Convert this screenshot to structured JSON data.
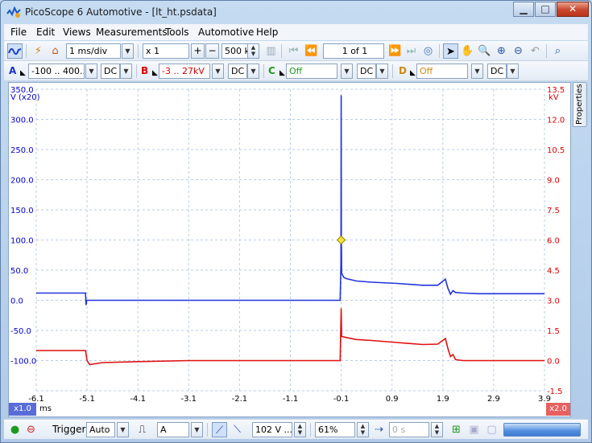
{
  "window": {
    "title": "PicoScope 6 Automotive - [lt_ht.psdata]"
  },
  "menu": [
    "File",
    "Edit",
    "Views",
    "Measurements",
    "Tools",
    "Automotive",
    "Help"
  ],
  "toolbar": {
    "timebase": "1 ms/div",
    "zoom": "x 1",
    "samples": "500 kS",
    "page": "1 of 1"
  },
  "channels": {
    "a": {
      "letter": "A",
      "range": "-100 .. 400...",
      "coupling": "DC"
    },
    "b": {
      "letter": "B",
      "range": "-3 .. 27kV",
      "coupling": "DC"
    },
    "c": {
      "letter": "C",
      "range": "Off",
      "coupling": "DC"
    },
    "d": {
      "letter": "D",
      "range": "Off",
      "coupling": "DC"
    }
  },
  "plot": {
    "left_unit": "V (x20)",
    "right_unit": "kV",
    "x_unit": "ms",
    "left_zoom": "x1.0",
    "right_zoom": "x2.0",
    "properties_tab": "Properties"
  },
  "status": {
    "trigger_label": "Trigger",
    "trigger_mode": "Auto",
    "trigger_channel": "A",
    "trigger_level": "102 V ...",
    "pretrigger": "61%",
    "delay": "0 s"
  },
  "colors": {
    "channel_a": "#2233dd",
    "channel_b": "#e01010",
    "marker": "#f2e23a"
  },
  "chart_data": {
    "type": "line",
    "x_ticks": [
      "-6.1",
      "-5.1",
      "-4.1",
      "-3.1",
      "-2.1",
      "-1.1",
      "-0.1",
      "0.9",
      "1.9",
      "2.9",
      "3.9"
    ],
    "y_left_ticks": [
      "350.0",
      "300.0",
      "250.0",
      "200.0",
      "150.0",
      "100.0",
      "50.0",
      "0.0",
      "-50.0",
      "-100.0"
    ],
    "y_right_ticks": [
      "13.5",
      "12.0",
      "10.5",
      "9.0",
      "7.5",
      "6.0",
      "4.5",
      "3.0",
      "1.5",
      "0.0",
      "-1.5"
    ],
    "xlim": [
      -6.1,
      3.9
    ],
    "ylim_left": [
      -150,
      350
    ],
    "ylim_right": [
      -1.5,
      13.5
    ],
    "grid": true,
    "series": [
      {
        "axis": "left",
        "x": [
          -6.1,
          -5.13,
          -5.12,
          -5.11,
          -5.1,
          -0.12,
          -0.105,
          -0.1,
          -0.097,
          -0.09,
          -0.05,
          0.0,
          0.2,
          0.5,
          1.0,
          1.5,
          1.8,
          1.95,
          2.0,
          2.05,
          2.1,
          2.15,
          2.3,
          2.6,
          3.9
        ],
        "y": [
          12,
          12,
          -8,
          0,
          0,
          0,
          60,
          340,
          110,
          45,
          38,
          36,
          32,
          30,
          28,
          25,
          25,
          35,
          20,
          10,
          16,
          13,
          12,
          11,
          11
        ]
      },
      {
        "axis": "right",
        "x": [
          -6.1,
          -5.13,
          -5.1,
          -5.05,
          -4.8,
          -4.1,
          -3.1,
          -2.1,
          -1.1,
          -0.12,
          -0.1,
          -0.09,
          0.0,
          0.2,
          0.5,
          1.0,
          1.5,
          1.8,
          1.95,
          2.0,
          2.05,
          2.1,
          2.15,
          2.3,
          2.6,
          3.9
        ],
        "y": [
          0.5,
          0.5,
          0.0,
          -0.2,
          -0.1,
          -0.05,
          0.0,
          0.0,
          0.0,
          0.0,
          2.6,
          1.2,
          1.15,
          1.05,
          1.0,
          0.9,
          0.8,
          0.82,
          1.1,
          0.6,
          0.2,
          0.3,
          0.05,
          0.0,
          0.0,
          0.0
        ]
      }
    ]
  }
}
